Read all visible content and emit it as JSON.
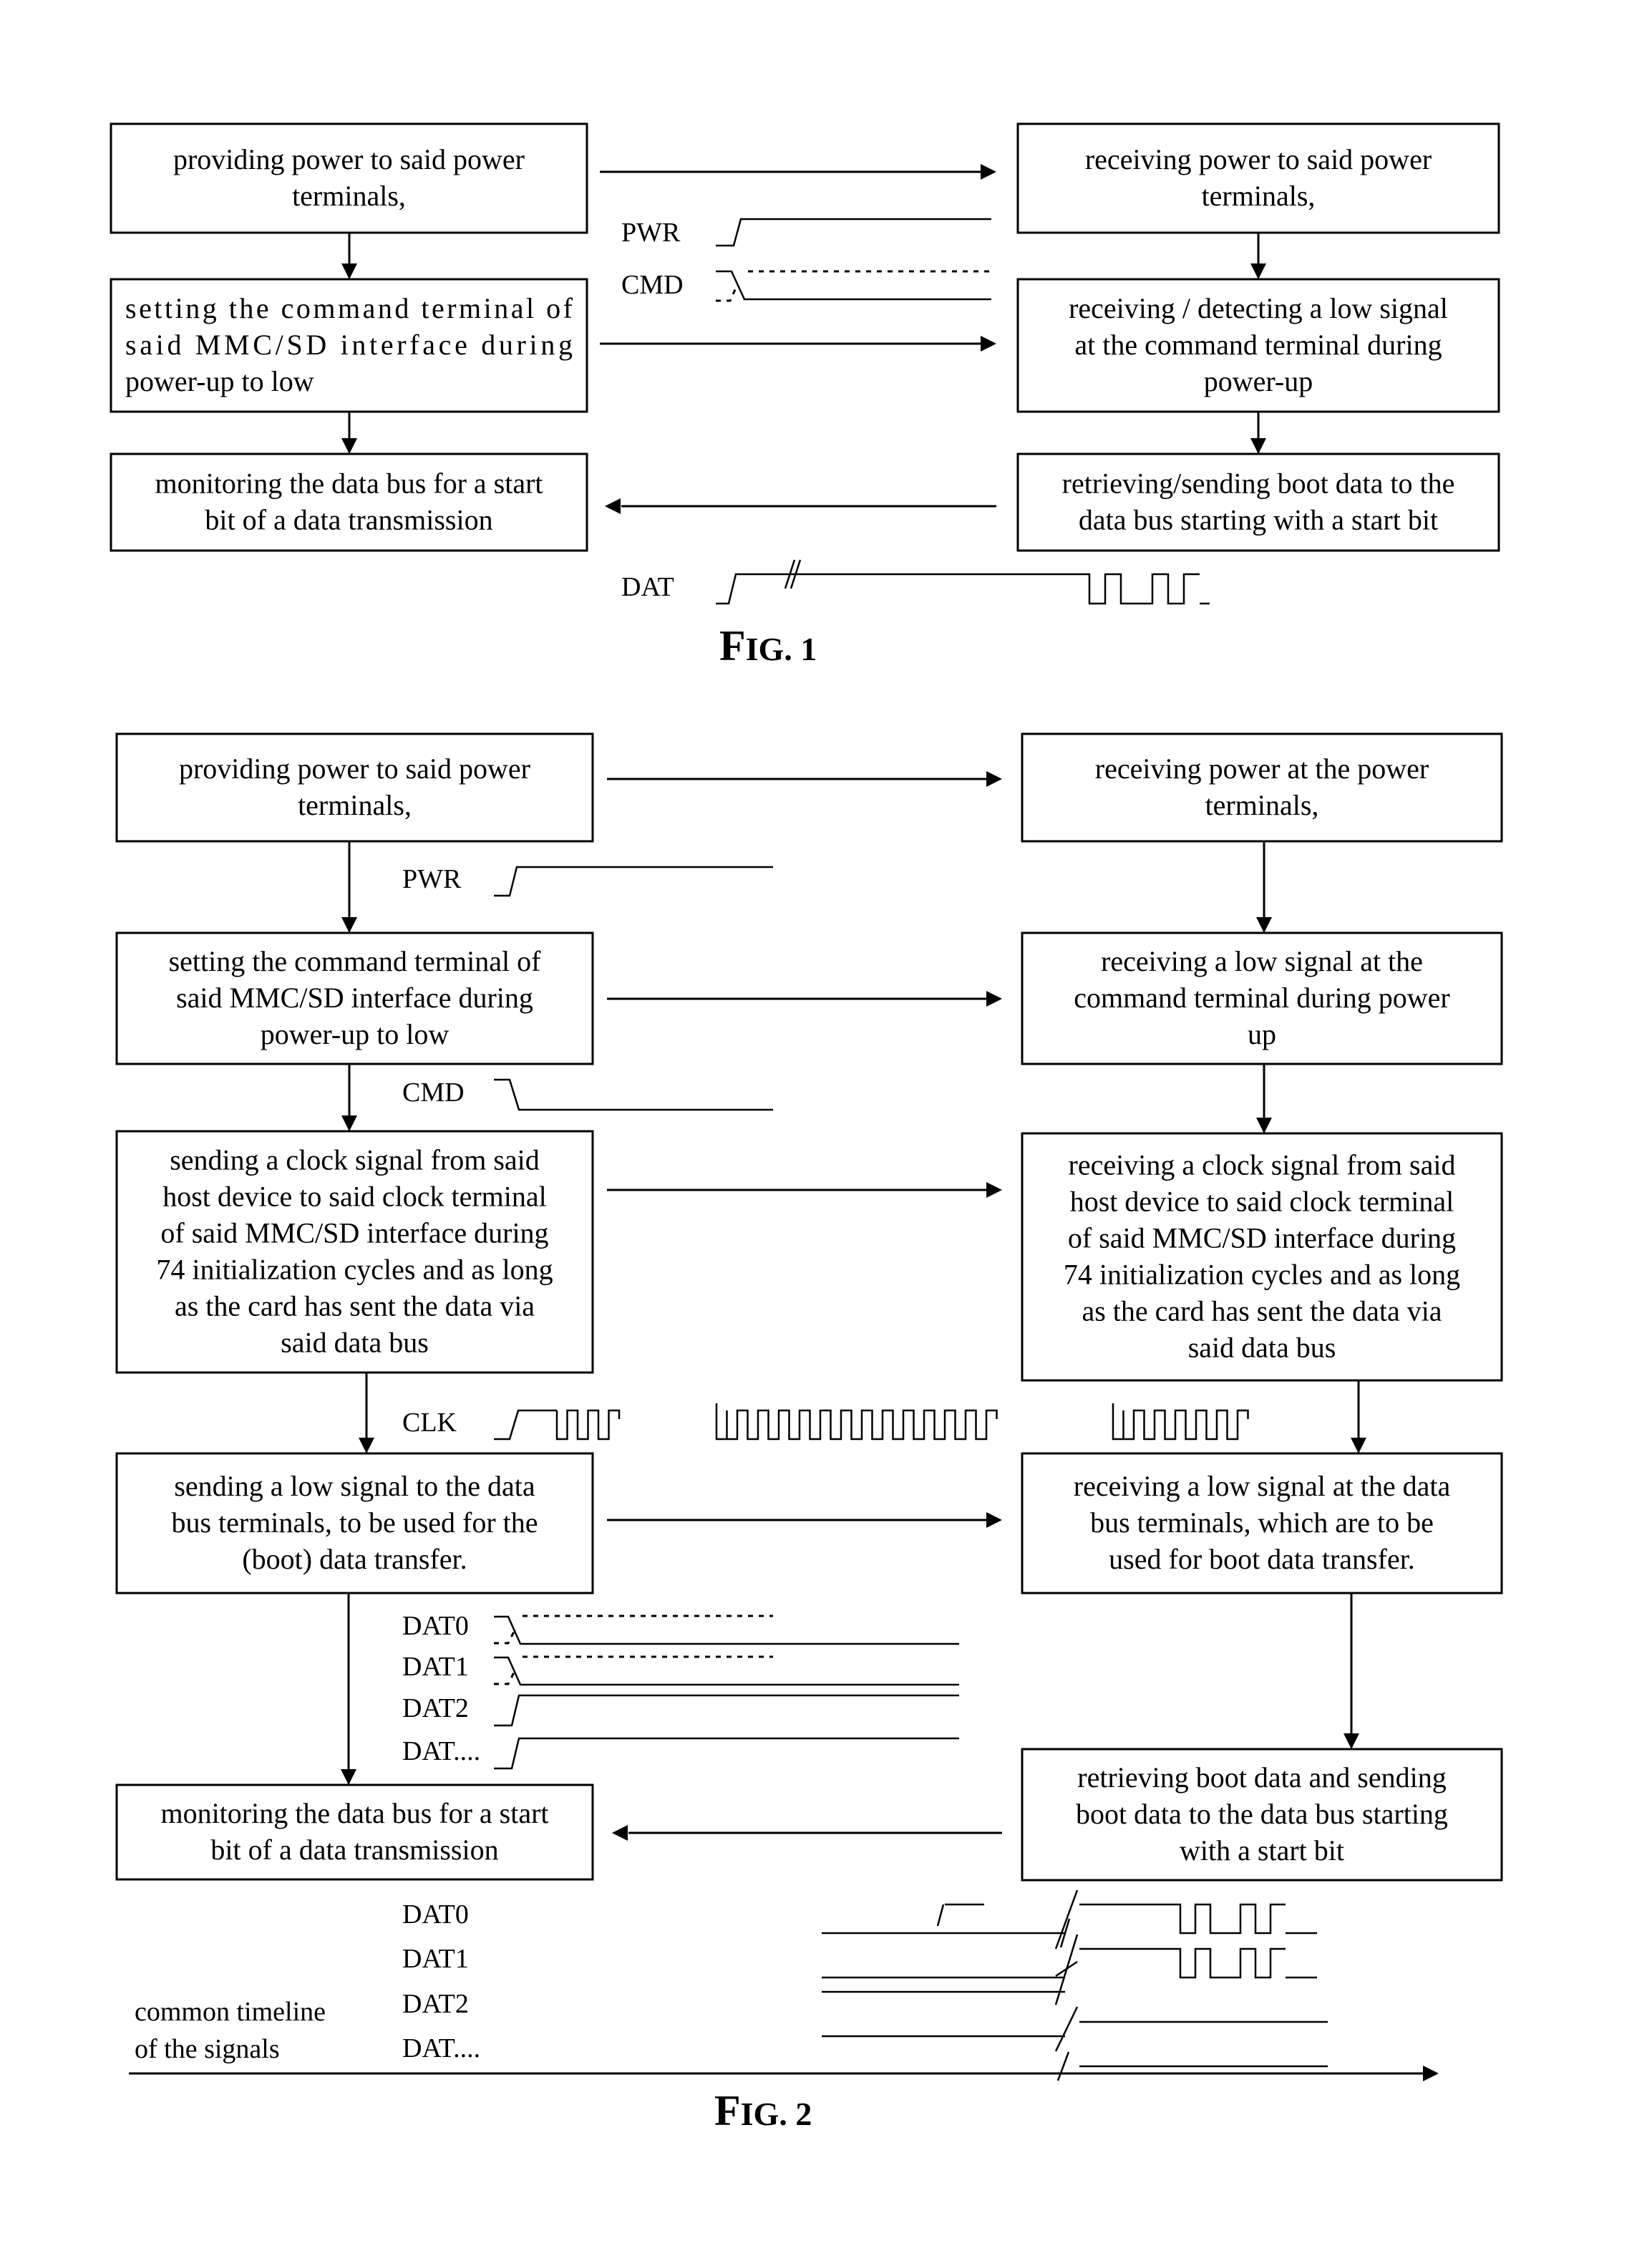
{
  "figures": [
    {
      "caption": "FIG. 1",
      "caption_big": "F",
      "caption_small": "IG. 1",
      "host_steps": [
        {
          "lines": [
            "providing power to said power",
            "terminals,"
          ]
        },
        {
          "lines": [
            "setting the command terminal of",
            "said MMC/SD interface during",
            "power-up to low"
          ],
          "justify": true
        },
        {
          "lines": [
            "monitoring the data bus for a start",
            "bit of a data transmission"
          ]
        }
      ],
      "card_steps": [
        {
          "lines": [
            "receiving power to said power",
            "terminals,"
          ]
        },
        {
          "lines": [
            "receiving / detecting a low signal",
            "at the command terminal during",
            "power-up"
          ]
        },
        {
          "lines": [
            "retrieving/sending boot data to the",
            "data bus starting with a start bit"
          ]
        }
      ],
      "signals": [
        {
          "name": "PWR",
          "type": "rise"
        },
        {
          "name": "CMD",
          "type": "fall-unknown"
        },
        {
          "name": "DAT",
          "type": "rise-then-data",
          "bits": [
            1,
            0,
            1,
            0,
            0,
            1,
            0,
            1
          ]
        }
      ],
      "arrows": [
        "host-to-card",
        "host-to-card",
        "card-to-host"
      ]
    },
    {
      "caption": "FIG. 2",
      "caption_big": "F",
      "caption_small": "IG. 2",
      "host_steps": [
        {
          "lines": [
            "providing power to said power",
            "terminals,"
          ]
        },
        {
          "lines": [
            "setting the command terminal of",
            "said MMC/SD interface during",
            "power-up to low"
          ]
        },
        {
          "lines": [
            "sending a clock signal from said",
            "host device to said clock terminal",
            "of said MMC/SD interface during",
            "74 initialization cycles and as long",
            "as the card has sent the data via",
            "said data bus"
          ]
        },
        {
          "lines": [
            "sending a low signal to the data",
            "bus terminals, to be used for the",
            "(boot) data transfer."
          ]
        },
        {
          "lines": [
            "monitoring the data bus for a start",
            "bit of a data transmission"
          ]
        }
      ],
      "card_steps": [
        {
          "lines": [
            "receiving power at the power",
            "terminals,"
          ]
        },
        {
          "lines": [
            "receiving a low signal at the",
            "command terminal during power",
            "up"
          ]
        },
        {
          "lines": [
            "receiving a clock signal from said",
            "host device to said clock terminal",
            "of said MMC/SD interface during",
            "74 initialization cycles and as long",
            "as the card has sent the data via",
            "said data bus"
          ]
        },
        {
          "lines": [
            "receiving a low signal at the data",
            "bus terminals, which are to be",
            "used for boot data transfer."
          ]
        },
        {
          "lines": [
            "retrieving boot data and sending",
            "boot data to the data bus starting",
            "with a start bit"
          ]
        }
      ],
      "signals": [
        {
          "name": "PWR",
          "type": "rise"
        },
        {
          "name": "CMD",
          "type": "fall"
        },
        {
          "name": "CLK",
          "type": "clock",
          "groups": [
            3,
            13,
            6
          ]
        },
        {
          "name": "DAT0",
          "type": "fall-unknown"
        },
        {
          "name": "DAT1",
          "type": "fall-unknown"
        },
        {
          "name": "DAT2",
          "type": "rise"
        },
        {
          "name": "DAT....",
          "type": "rise"
        }
      ],
      "timeline": {
        "label_lines": [
          "common timeline",
          "of the signals"
        ],
        "signals": [
          {
            "name": "DAT0",
            "type": "low-break-data",
            "bits": [
              1,
              0,
              1,
              0,
              0,
              1,
              0,
              1
            ]
          },
          {
            "name": "DAT1",
            "type": "low-break-data",
            "bits": [
              1,
              0,
              1,
              0,
              0,
              1,
              0,
              1
            ]
          },
          {
            "name": "DAT2",
            "type": "low-break-high"
          },
          {
            "name": "DAT....",
            "type": "low-break-high"
          }
        ]
      },
      "arrows": [
        "host-to-card",
        "host-to-card",
        "host-to-card",
        "host-to-card",
        "card-to-host"
      ]
    }
  ]
}
